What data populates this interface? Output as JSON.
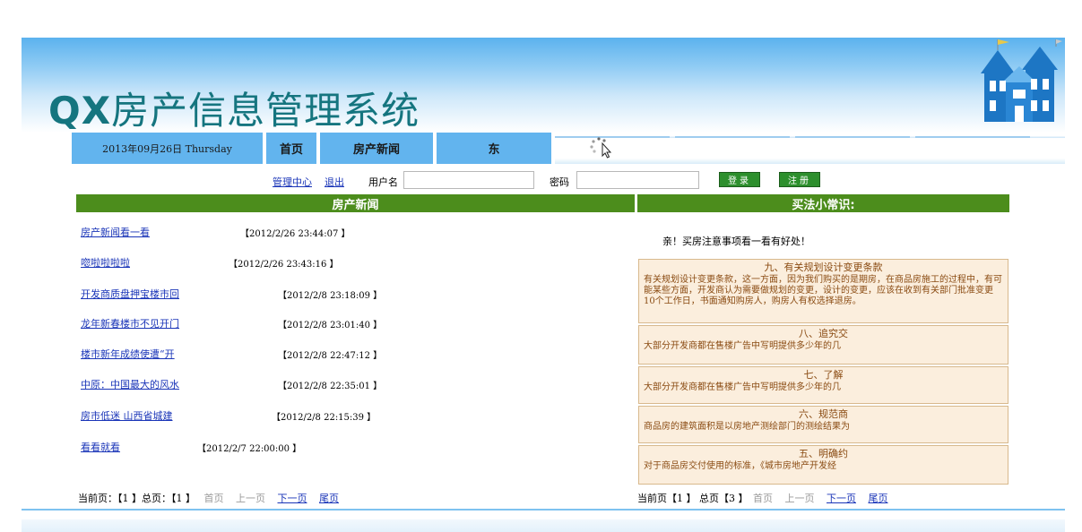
{
  "banner": {
    "title_latin": "QX",
    "title_cn": "房产信息管理系统"
  },
  "nav": {
    "date": "2013年09月26日 Thursday",
    "home": "首页",
    "news": "房产新闻",
    "east": "东"
  },
  "login": {
    "admin_link": "管理中心",
    "logout_link": "退出",
    "username_label": "用户名",
    "username_value": "",
    "password_label": "密码",
    "password_value": "",
    "login_button": "登录",
    "register_button": "注册"
  },
  "news": {
    "header": "房产新闻",
    "items": [
      {
        "title": "房产新闻看一看",
        "time": "【2012/2/26 23:44:07 】"
      },
      {
        "title": "唿啦啦啦啦",
        "time": "【2012/2/26 23:43:16 】"
      },
      {
        "title": "开发商质盘押宝楼市回",
        "time": "【2012/2/8 23:18:09 】"
      },
      {
        "title": "龙年新春楼市不见开门",
        "time": "【2012/2/8 23:01:40 】"
      },
      {
        "title": "楼市新年成绩使遭“开",
        "time": "【2012/2/8 22:47:12 】"
      },
      {
        "title": "中原：中国最大的风水",
        "time": "【2012/2/8 22:35:01 】"
      },
      {
        "title": "房市低迷 山西省城建",
        "time": "【2012/2/8 22:15:39 】"
      },
      {
        "title": "看看就看",
        "time": "【2012/2/7 22:00:00 】"
      }
    ],
    "pager": {
      "current_label": "当前页：【1 】总页：【1 】",
      "first": "首页",
      "prev": "上一页",
      "next": "下一页",
      "last": "尾页"
    }
  },
  "tips": {
    "header": "买法小常识:",
    "intro": "亲！买房注意事项看一看有好处！",
    "items": [
      {
        "title": "九、有关规划设计变更条款",
        "body": "有关规划设计变更条款，这一方面，因为我们购买的是期房，在商品房施工的过程中，有可能某些方面，开发商认为需要做规划的变更，设计的变更，应该在收到有关部门批准变更10个工作日，书面通知购房人，购房人有权选择退房。"
      },
      {
        "title": "八、追究交",
        "body": "大部分开发商都在售楼广告中写明提供多少年的几"
      },
      {
        "title": "七、了解",
        "body": "大部分开发商都在售楼广告中写明提供多少年的几"
      },
      {
        "title": "六、规范商",
        "body": "商品房的建筑面积是以房地产测绘部门的测绘结果为"
      },
      {
        "title": "五、明确约",
        "body": "对于商品房交付使用的标准，《城市房地产开发经"
      }
    ],
    "pager": {
      "current_label": "当前页【1 】 总页【3 】",
      "first": "首页",
      "prev": "上一页",
      "next": "下一页",
      "last": "尾页"
    }
  },
  "colors": {
    "banner_blue": "#5bb2ee",
    "nav_blue": "#62b4ee",
    "section_green": "#4c8d1c",
    "link_blue": "#1a35b8",
    "tip_bg": "#fbeedd",
    "title_teal": "#15757f"
  },
  "icons": [
    "house-logo-icon",
    "loading-spinner-icon"
  ]
}
